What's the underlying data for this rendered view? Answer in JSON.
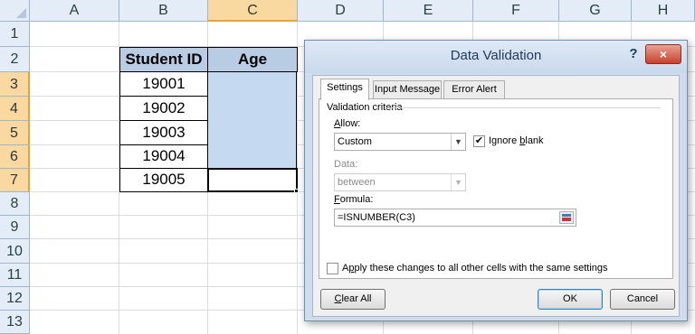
{
  "columns": [
    "A",
    "B",
    "C",
    "D",
    "E",
    "F",
    "G",
    "H"
  ],
  "rows": [
    "1",
    "2",
    "3",
    "4",
    "5",
    "6",
    "7",
    "8",
    "9",
    "10",
    "11",
    "12",
    "13"
  ],
  "table": {
    "header_student_id": "Student ID",
    "header_age": "Age",
    "student_ids": [
      "19001",
      "19002",
      "19003",
      "19004",
      "19005"
    ]
  },
  "dialog": {
    "title": "Data Validation",
    "help": "?",
    "close": "×",
    "tabs": [
      "Settings",
      "Input Message",
      "Error Alert"
    ],
    "active_tab": "Settings",
    "validation_criteria_label": "Validation criteria",
    "allow_label_u": "A",
    "allow_label_rest": "llow:",
    "allow_value": "Custom",
    "ignore_blank_checked": true,
    "ignore_blank_prefix": "Ignore ",
    "ignore_blank_u": "b",
    "ignore_blank_rest": "lank",
    "data_label": "Data:",
    "data_value": "between",
    "formula_label_u": "F",
    "formula_label_rest": "ormula:",
    "formula_value": "=ISNUMBER(C3)",
    "apply_checked": false,
    "apply_prefix": "A",
    "apply_u": "p",
    "apply_rest": "ply these changes to all other cells with the same settings",
    "clear_all_u": "C",
    "clear_all_rest": "lear All",
    "ok_label": "OK",
    "cancel_label": "Cancel"
  },
  "colors": {
    "header_fill": "#b8cce4",
    "selection_fill": "#c5d9f1",
    "selected_header": "#f9d99f",
    "close_button": "#c8412c"
  },
  "icons": {
    "dropdown": "▼",
    "checkmark": "✔"
  }
}
